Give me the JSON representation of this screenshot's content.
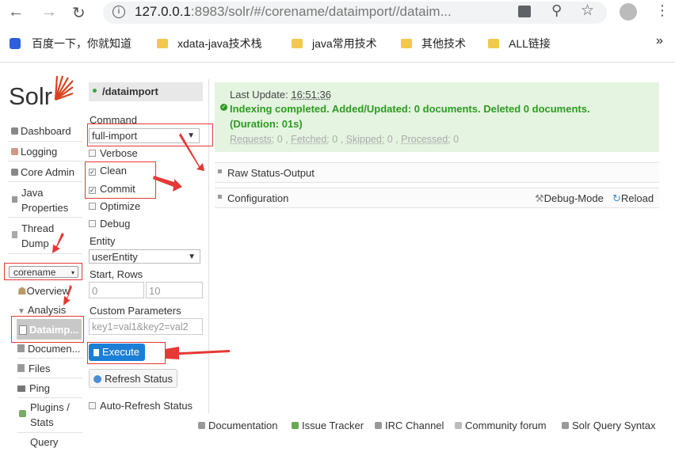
{
  "browser": {
    "url_host": "127.0.0.1",
    "url_rest": ":8983/solr/#/corename/dataimport//dataim...",
    "bookmarks": [
      "百度一下，你就知道",
      "xdata-java技术栈",
      "java常用技术",
      "其他技术",
      "ALL链接"
    ],
    "overflow": "»"
  },
  "nav": {
    "logo": "Solr",
    "items": [
      "Dashboard",
      "Logging",
      "Core Admin",
      "Java",
      "Properties",
      "Thread",
      "Dump"
    ],
    "core_selector": "corename",
    "core_items": [
      "Overview",
      "Analysis",
      "Dataimp...",
      "Documen...",
      "Files",
      "Ping",
      "Plugins /",
      "Stats",
      "Query"
    ]
  },
  "form": {
    "header": "/dataimport",
    "command_label": "Command",
    "command_value": "full-import",
    "verbose": "Verbose",
    "clean": "Clean",
    "commit": "Commit",
    "optimize": "Optimize",
    "debug": "Debug",
    "entity_label": "Entity",
    "entity_value": "userEntity",
    "start_rows_label": "Start, Rows",
    "start_value": "0",
    "rows_value": "10",
    "custom_params_label": "Custom Parameters",
    "custom_params_value": "key1=val1&key2=val2",
    "execute": "Execute",
    "refresh": "Refresh Status",
    "auto_refresh": "Auto-Refresh Status"
  },
  "status": {
    "last_update_label": "Last Update:",
    "last_update_time": "16:51:36",
    "message_line1": "Indexing completed. Added/Updated: 0 documents. Deleted 0 documents.",
    "message_line2": "(Duration: 01s)",
    "requests_label": "Requests:",
    "requests": "0",
    "fetched_label": "Fetched:",
    "fetched": "0",
    "skipped_label": "Skipped:",
    "skipped": "0",
    "processed_label": "Processed:",
    "processed": "0",
    "status_color": "#2e9b22"
  },
  "panels": {
    "raw": "Raw Status-Output",
    "config": "Configuration",
    "debug_mode": "Debug-Mode",
    "reload": "Reload"
  },
  "footer": [
    "Documentation",
    "Issue Tracker",
    "IRC Channel",
    "Community forum",
    "Solr Query Syntax"
  ]
}
